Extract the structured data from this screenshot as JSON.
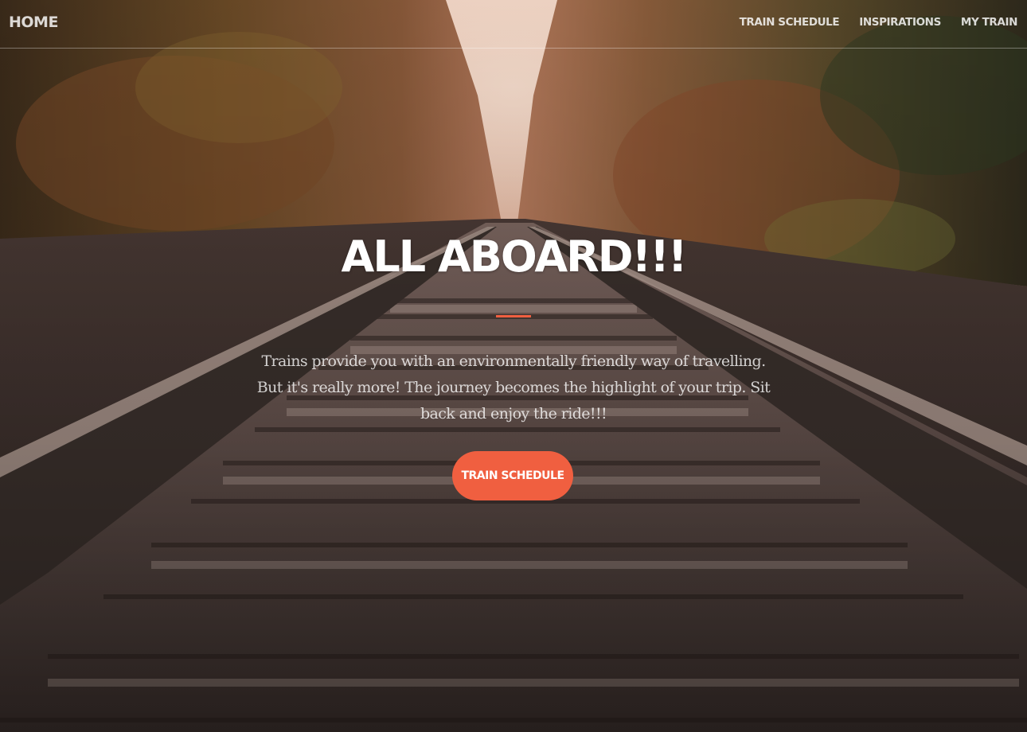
{
  "navbar": {
    "brand": "HOME",
    "links": [
      {
        "label": "TRAIN SCHEDULE"
      },
      {
        "label": "INSPIRATIONS"
      },
      {
        "label": "MY TRAIN"
      }
    ]
  },
  "hero": {
    "heading": "ALL ABOARD!!!",
    "description": "Trains provide you with an environmentally friendly way of travelling. But it's really more! The journey becomes the highlight of your trip. Sit back and enjoy the ride!!!",
    "cta_label": "TRAIN SCHEDULE"
  },
  "colors": {
    "accent": "#f05f40",
    "text": "#ffffff"
  }
}
